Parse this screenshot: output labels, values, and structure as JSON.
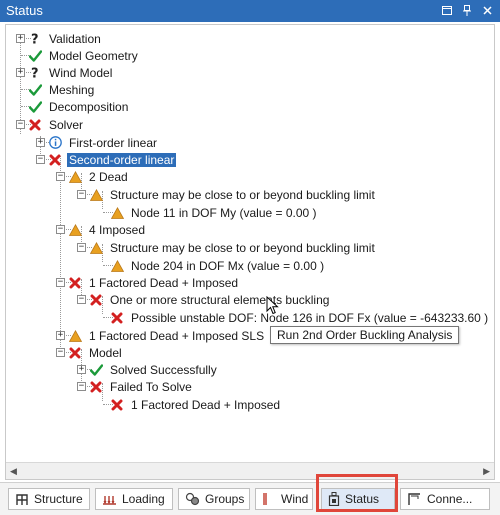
{
  "window": {
    "title": "Status"
  },
  "colors": {
    "accent": "#2d6db8",
    "success": "#1b9a3a",
    "error": "#d32020",
    "warning": "#e8a020",
    "info": "#2a74c9",
    "highlight": "#e0463a"
  },
  "tree": [
    {
      "label": "Validation",
      "icon": "question-icon"
    },
    {
      "label": "Model Geometry",
      "icon": "check-icon"
    },
    {
      "label": "Wind Model",
      "icon": "question-icon"
    },
    {
      "label": "Meshing",
      "icon": "check-icon"
    },
    {
      "label": "Decomposition",
      "icon": "check-icon"
    },
    {
      "label": "Solver",
      "icon": "error-icon"
    },
    {
      "label": "First-order linear",
      "icon": "info-icon"
    },
    {
      "label": "Second-order linear",
      "icon": "error-icon",
      "selected": true
    },
    {
      "label": "2 Dead",
      "icon": "warning-icon"
    },
    {
      "label": "Structure may be close to or beyond buckling limit",
      "icon": "warning-icon"
    },
    {
      "label": "Node 11 in DOF My (value = 0.00 )",
      "icon": "warning-icon"
    },
    {
      "label": "4 Imposed",
      "icon": "warning-icon"
    },
    {
      "label": "Structure may be close to or beyond buckling limit",
      "icon": "warning-icon"
    },
    {
      "label": "Node 204 in DOF Mx (value = 0.00 )",
      "icon": "warning-icon"
    },
    {
      "label": "1 Factored Dead + Imposed",
      "icon": "error-icon"
    },
    {
      "label": "One or more structural elements buckling",
      "icon": "error-icon"
    },
    {
      "label": "Possible unstable DOF: Node 126 in DOF Fx (value = -643233.60 )",
      "icon": "error-icon"
    },
    {
      "label": "1 Factored Dead + Imposed SLS",
      "icon": "warning-icon"
    },
    {
      "label": "Model",
      "icon": "error-icon"
    },
    {
      "label": "Solved Successfully",
      "icon": "check-icon"
    },
    {
      "label": "Failed To Solve",
      "icon": "error-icon"
    },
    {
      "label": "1 Factored Dead + Imposed",
      "icon": "error-icon"
    }
  ],
  "tooltip": {
    "text": "Run 2nd Order Buckling Analysis"
  },
  "tabs": [
    {
      "label": "Structure",
      "icon": "structure-icon"
    },
    {
      "label": "Loading",
      "icon": "loading-icon"
    },
    {
      "label": "Groups",
      "icon": "groups-icon"
    },
    {
      "label": "Wind",
      "icon": "wind-icon"
    },
    {
      "label": "Status",
      "icon": "status-icon",
      "active": true
    },
    {
      "label": "Conne...",
      "icon": "connection-icon"
    }
  ]
}
